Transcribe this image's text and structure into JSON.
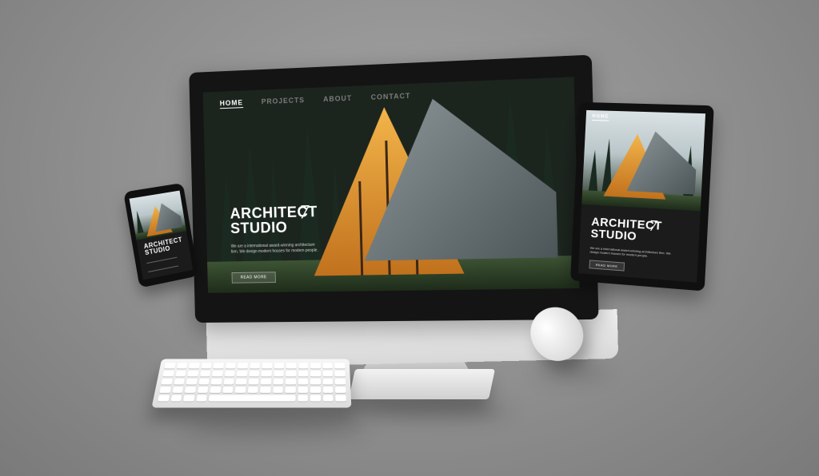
{
  "scene": {
    "description_colors": {
      "background": "#8e8e8e",
      "accent_wood": "#f3b54a",
      "device_black": "#141414"
    }
  },
  "desktop_site": {
    "nav": [
      "HOME",
      "PROJECTS",
      "ABOUT",
      "CONTACT"
    ],
    "title_line1": "ARCHITECT",
    "title_line2": "STUDIO",
    "description": "We are a international award-winning architecture firm. We design modern houses for modern people.",
    "button": "READ MORE"
  },
  "tablet_site": {
    "nav": [
      "HOME"
    ],
    "title_line1": "ARCHITECT",
    "title_line2": "STUDIO",
    "description": "We are a international award-winning architecture firm. We design modern houses for modern people.",
    "button": "READ MORE"
  },
  "phone_site": {
    "title_line1": "ARCHITECT",
    "title_line2": "STUDIO"
  }
}
